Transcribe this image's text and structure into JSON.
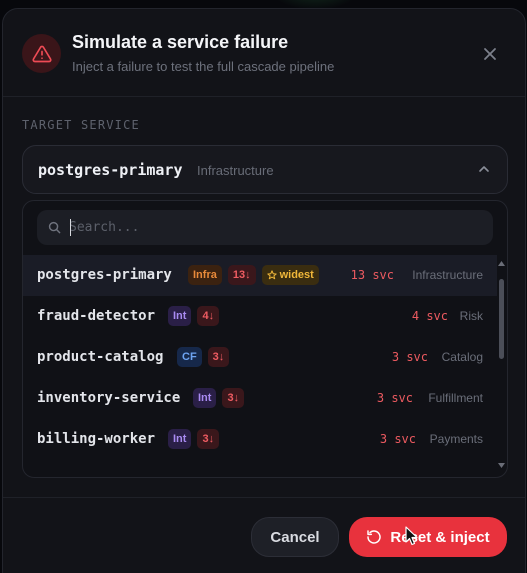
{
  "dialog": {
    "title": "Simulate a service failure",
    "subtitle": "Inject a failure to test the full cascade pipeline"
  },
  "target": {
    "section_label": "TARGET SERVICE",
    "selected_name": "postgres-primary",
    "selected_category": "Infrastructure"
  },
  "search": {
    "placeholder": "Search..."
  },
  "services": [
    {
      "name": "postgres-primary",
      "type_badge": "Infra",
      "count_badge": "13↓",
      "extra_badge": "widest",
      "svc": "13 svc",
      "category": "Infrastructure"
    },
    {
      "name": "fraud-detector",
      "type_badge": "Int",
      "count_badge": "4↓",
      "svc": "4 svc",
      "category": "Risk"
    },
    {
      "name": "product-catalog",
      "type_badge": "CF",
      "count_badge": "3↓",
      "svc": "3 svc",
      "category": "Catalog"
    },
    {
      "name": "inventory-service",
      "type_badge": "Int",
      "count_badge": "3↓",
      "svc": "3 svc",
      "category": "Fulfillment"
    },
    {
      "name": "billing-worker",
      "type_badge": "Int",
      "count_badge": "3↓",
      "svc": "3 svc",
      "category": "Payments"
    }
  ],
  "footer": {
    "cancel_label": "Cancel",
    "inject_label": "Reset & inject"
  },
  "icons": {
    "header": "alert-triangle-icon",
    "close": "close-icon",
    "select": "chevron-up-icon",
    "search": "search-icon",
    "widest": "star-icon",
    "inject": "rotate-ccw-icon"
  },
  "colors": {
    "accent": "#e8323d",
    "background": "#121318",
    "danger_text": "#ec5a60"
  }
}
